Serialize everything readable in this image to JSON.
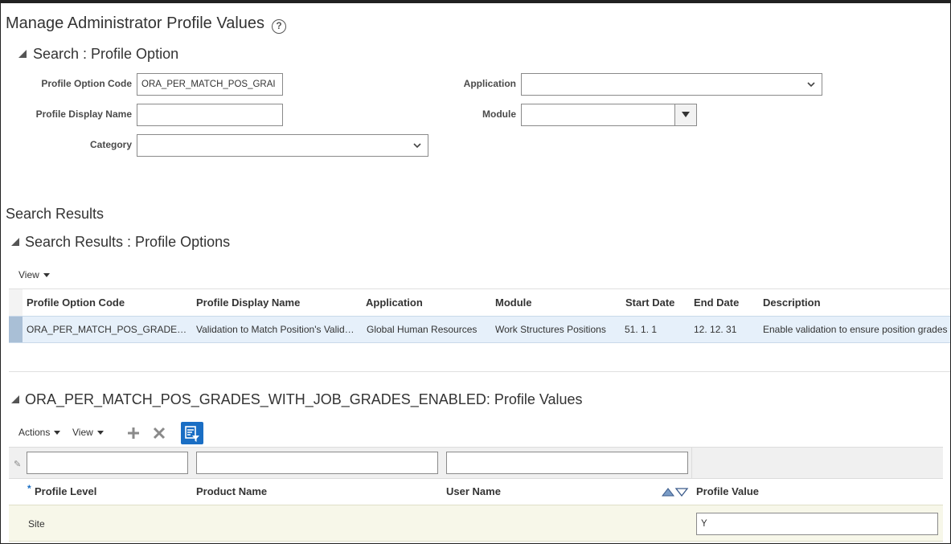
{
  "page": {
    "title": "Manage Administrator Profile Values",
    "help_icon": "question-circle-icon"
  },
  "search": {
    "section_title": "Search : Profile Option",
    "profile_option_code_label": "Profile Option Code",
    "profile_option_code_value": "ORA_PER_MATCH_POS_GRAI",
    "profile_display_name_label": "Profile Display Name",
    "profile_display_name_value": "",
    "category_label": "Category",
    "category_value": "",
    "application_label": "Application",
    "application_value": "",
    "module_label": "Module",
    "module_value": ""
  },
  "results": {
    "heading": "Search Results",
    "section_title": "Search Results : Profile Options",
    "view_label": "View",
    "columns": [
      "Profile Option Code",
      "Profile Display Name",
      "Application",
      "Module",
      "Start Date",
      "End Date",
      "Description"
    ],
    "rows": [
      {
        "profile_option_code": "ORA_PER_MATCH_POS_GRADE…",
        "profile_display_name": "Validation to Match Position's Valid…",
        "application": "Global Human Resources",
        "module": "Work Structures Positions",
        "start_date": "51. 1. 1",
        "end_date": "12. 12. 31",
        "description": "Enable validation to ensure position grades"
      }
    ]
  },
  "values": {
    "section_title": "ORA_PER_MATCH_POS_GRADES_WITH_JOB_GRADES_ENABLED: Profile Values",
    "actions_label": "Actions",
    "view_label": "View",
    "required_marker": "*",
    "columns": [
      "Profile Level",
      "Product Name",
      "User Name",
      "Profile Value"
    ],
    "rows": [
      {
        "profile_level": "Site",
        "product_name": "",
        "user_name": "",
        "profile_value": "Y"
      }
    ]
  },
  "colors": {
    "selected_row": "#e6f0fa",
    "selected_marker": "#a9bfd6",
    "filter_button": "#1a6ec4",
    "editable_row": "#f7f7e9"
  }
}
